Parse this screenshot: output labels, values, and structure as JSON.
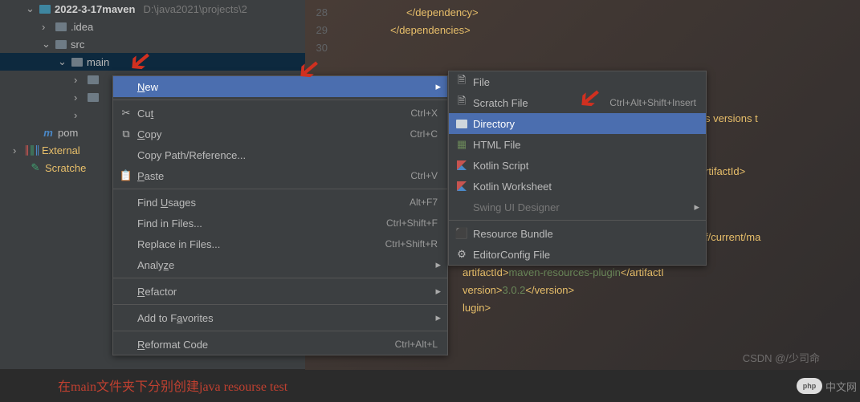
{
  "tree": {
    "root": "2022-3-17maven",
    "root_path": "D:\\java2021\\projects\\2",
    "idea": ".idea",
    "src": "src",
    "main": "main",
    "pom": "pom",
    "external": "External",
    "scratches": "Scratche"
  },
  "code": {
    "l28": "28",
    "t28": "</dependency>",
    "l29": "29",
    "t29": "</dependencies>",
    "l30": "30",
    "frag1": "s versions t",
    "frag2": "rtifactId>",
    "frag3": "f/current/ma",
    "frag4": "ugin>",
    "frag5_a": "artifactId>",
    "frag5_b": "maven-resources-plugin",
    "frag5_c": "</artifactI",
    "frag6_a": "version>",
    "frag6_b": "3.0.2",
    "frag6_c": "</version>",
    "frag7": "lugin>"
  },
  "ctx": {
    "new": "New",
    "cut": "Cut",
    "cut_k": "Ctrl+X",
    "copy": "Copy",
    "copy_k": "Ctrl+C",
    "copypath": "Copy Path/Reference...",
    "paste": "Paste",
    "paste_k": "Ctrl+V",
    "findusages": "Find Usages",
    "findusages_k": "Alt+F7",
    "findfiles": "Find in Files...",
    "findfiles_k": "Ctrl+Shift+F",
    "replacefiles": "Replace in Files...",
    "replacefiles_k": "Ctrl+Shift+R",
    "analyze": "Analyze",
    "refactor": "Refactor",
    "favorites": "Add to Favorites",
    "reformat": "Reformat Code",
    "reformat_k": "Ctrl+Alt+L"
  },
  "sub": {
    "file": "File",
    "scratch": "Scratch File",
    "scratch_k": "Ctrl+Alt+Shift+Insert",
    "directory": "Directory",
    "html": "HTML File",
    "kscript": "Kotlin Script",
    "kws": "Kotlin Worksheet",
    "swing": "Swing UI Designer",
    "bundle": "Resource Bundle",
    "editorconfig": "EditorConfig File"
  },
  "caption": "在main文件夹下分别创建java resourse test",
  "watermark1": "CSDN @/少司命",
  "watermark2": "中文网",
  "php": "php"
}
